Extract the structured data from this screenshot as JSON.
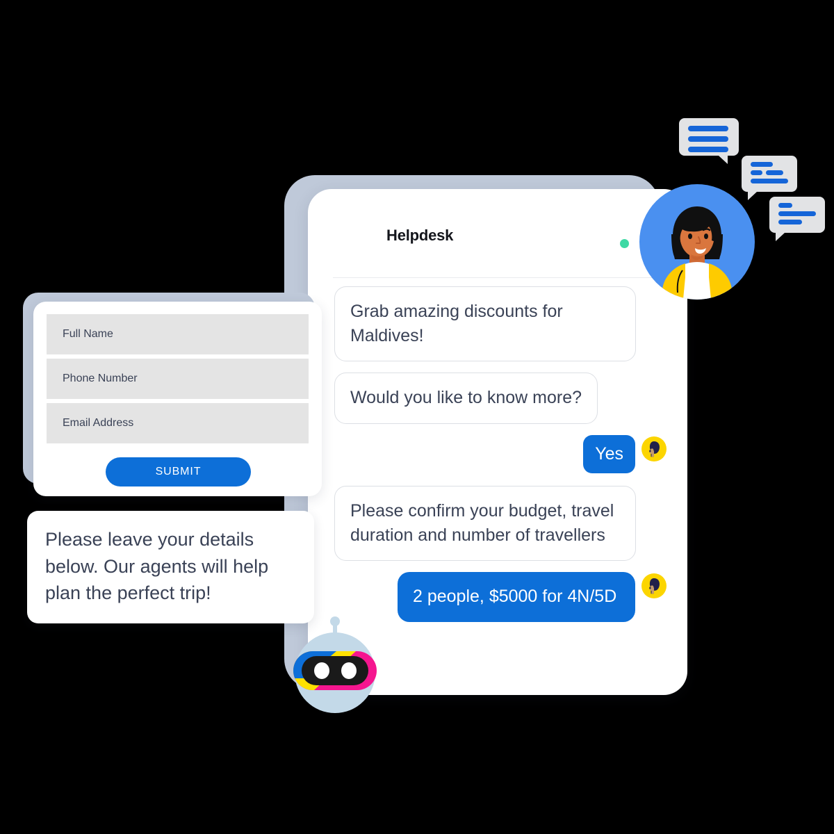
{
  "colors": {
    "accent_blue": "#0d6fd8",
    "panel_backing": "#bfc9d9",
    "field_bg": "#e4e4e4",
    "text_dark": "#3a4256",
    "title_dark": "#14161c",
    "status_green": "#3ed9a4",
    "bubble_border": "#dcdfe4",
    "avatar_blue": "#4a90f0",
    "avatar_yellow": "#fcd500",
    "robot_head": "#c3d9e8",
    "robot_pink": "#f5168f",
    "robot_yellow": "#ffe200",
    "robot_blue": "#0d6fd8",
    "background": "#000000"
  },
  "chat_panel": {
    "title": "Helpdesk",
    "status_dot": "online-status-dot",
    "messages": [
      {
        "id": "msg-1",
        "sender": "bot",
        "text": "Grab amazing discounts for Maldives!"
      },
      {
        "id": "msg-2",
        "sender": "bot",
        "text": "Would you like to know more?"
      },
      {
        "id": "msg-3",
        "sender": "user",
        "text": "Yes"
      },
      {
        "id": "msg-4",
        "sender": "bot",
        "text": "Please confirm your budget, travel duration and number of travellers"
      },
      {
        "id": "msg-5",
        "sender": "user",
        "text": "2 people, $5000 for 4N/5D"
      }
    ]
  },
  "lead_form": {
    "fields": [
      {
        "id": "full-name",
        "placeholder": "Full Name"
      },
      {
        "id": "phone-number",
        "placeholder": "Phone Number"
      },
      {
        "id": "email-address",
        "placeholder": "Email Address"
      }
    ],
    "submit_label": "SUBMIT"
  },
  "speech_bubble": {
    "text": "Please leave your details below. Our agents will help plan the perfect trip!"
  },
  "decorations": {
    "agent_avatar": "agent-avatar-woman",
    "user_avatar": "user-avatar-profile",
    "robot_mascot": "robot-mascot",
    "chat_bubble_icons": [
      "chat-bubble-icon-1",
      "chat-bubble-icon-2",
      "chat-bubble-icon-3"
    ]
  }
}
